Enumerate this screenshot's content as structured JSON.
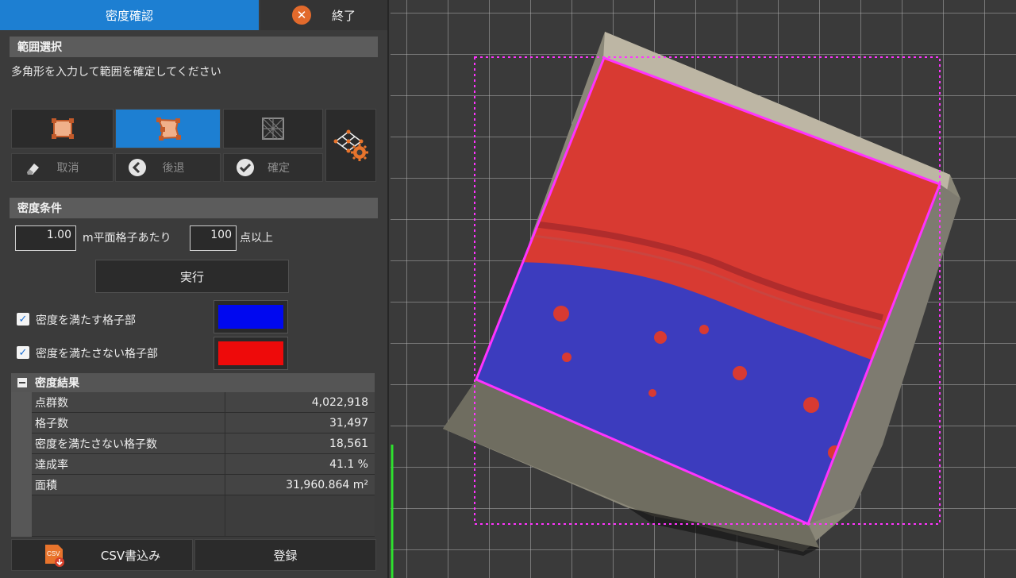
{
  "tabs": {
    "density_check": "密度確認",
    "exit": "終了"
  },
  "range_selection": {
    "header": "範囲選択",
    "instruction": "多角形を入力して範囲を確定してください",
    "cancel_label": "取消",
    "back_label": "後退",
    "confirm_label": "確定"
  },
  "density_conditions": {
    "header": "密度条件",
    "grid_size": "1.00",
    "grid_unit_text": "m平面格子あたり",
    "min_points": "100",
    "min_points_unit": "点以上",
    "run_label": "実行",
    "satisfied_label": "密度を満たす格子部",
    "satisfied_checked": true,
    "satisfied_color": "#0008f0",
    "unsatisfied_label": "密度を満たさない格子部",
    "unsatisfied_checked": true,
    "unsatisfied_color": "#ee0a0a"
  },
  "results": {
    "header": "密度結果",
    "rows": [
      {
        "label": "点群数",
        "value": "4,022,918"
      },
      {
        "label": "格子数",
        "value": "31,497"
      },
      {
        "label": "密度を満たさない格子数",
        "value": "18,561"
      },
      {
        "label": "達成率",
        "value": "41.1 %"
      },
      {
        "label": "面積",
        "value": "31,960.864 m²"
      }
    ]
  },
  "bottom": {
    "csv_label": "CSV書込み",
    "csv_icon_text": "CSV",
    "register_label": "登録"
  },
  "colors": {
    "accent": "#1d7fd2",
    "selection_outline": "#ff33ff"
  }
}
